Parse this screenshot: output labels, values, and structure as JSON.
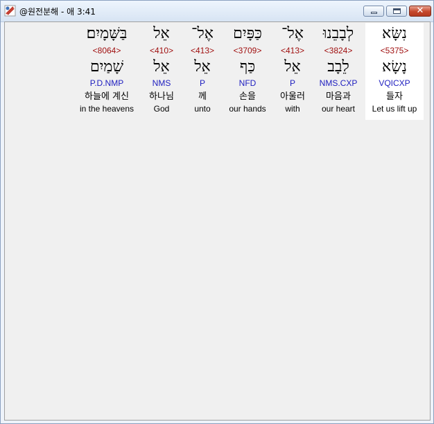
{
  "window": {
    "title": "@원전분해 - 애 3:41",
    "close_glyph": "✕",
    "icons": {
      "app": "app-logo-icon",
      "minimize": "minimize-icon",
      "maximize": "maximize-icon",
      "close": "close-icon"
    }
  },
  "words": [
    {
      "hebrew": "בַּשָּׁמָיִם׃",
      "strong": "<8064>",
      "lexeme": "שָׁמַיִם",
      "morph": "P.D.NMP",
      "korean": "하늘에 계신",
      "english": "in the heavens"
    },
    {
      "hebrew": "אֵל",
      "strong": "<410>",
      "lexeme": "אֵל",
      "morph": "NMS",
      "korean": "하나님",
      "english": "God"
    },
    {
      "hebrew": "אֶל־",
      "strong": "<413>",
      "lexeme": "אֵל",
      "morph": "P",
      "korean": "께",
      "english": "unto"
    },
    {
      "hebrew": "כַּפָּיִם",
      "strong": "<3709>",
      "lexeme": "כַּף",
      "morph": "NFD",
      "korean": "손을",
      "english": "our hands"
    },
    {
      "hebrew": "אֶל־",
      "strong": "<413>",
      "lexeme": "אֵל",
      "morph": "P",
      "korean": "아울러",
      "english": "with"
    },
    {
      "hebrew": "לְבָבֵנוּ",
      "strong": "<3824>",
      "lexeme": "לֵבָב",
      "morph": "NMS.CXP",
      "korean": "마음과",
      "english": "our heart"
    },
    {
      "hebrew": "נִשָּׂא",
      "strong": "<5375>",
      "lexeme": "נָשָׂא",
      "morph": "VQICXP",
      "korean": "들자",
      "english": "Let us lift up"
    }
  ]
}
